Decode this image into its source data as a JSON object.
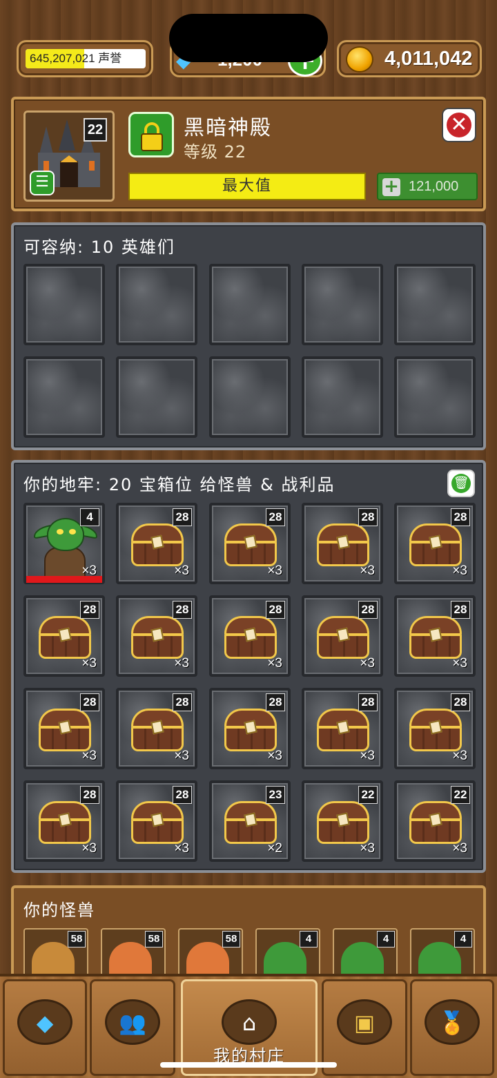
{
  "topbar": {
    "reputation_value": "645,207,021",
    "reputation_label": "声誉",
    "reputation_fill": 0.49,
    "gems_value": "1,200",
    "gold_value": "4,011,042"
  },
  "building": {
    "level_badge": "22",
    "name": "黑暗神殿",
    "level_text": "等级 22",
    "max_label": "最大值",
    "upgrade_cost": "121,000"
  },
  "heroes": {
    "title": "可容纳: 10 英雄们",
    "slot_count": 10
  },
  "dungeon": {
    "title": "你的地牢: 20 宝箱位 给怪兽 & 战利品",
    "items": [
      {
        "type": "goblin",
        "level": "4",
        "qty": "×3"
      },
      {
        "type": "chest",
        "level": "28",
        "qty": "×3"
      },
      {
        "type": "chest",
        "level": "28",
        "qty": "×3"
      },
      {
        "type": "chest",
        "level": "28",
        "qty": "×3"
      },
      {
        "type": "chest",
        "level": "28",
        "qty": "×3"
      },
      {
        "type": "chest",
        "level": "28",
        "qty": "×3"
      },
      {
        "type": "chest",
        "level": "28",
        "qty": "×3"
      },
      {
        "type": "chest",
        "level": "28",
        "qty": "×3"
      },
      {
        "type": "chest",
        "level": "28",
        "qty": "×3"
      },
      {
        "type": "chest",
        "level": "28",
        "qty": "×3"
      },
      {
        "type": "chest",
        "level": "28",
        "qty": "×3"
      },
      {
        "type": "chest",
        "level": "28",
        "qty": "×3"
      },
      {
        "type": "chest",
        "level": "28",
        "qty": "×3"
      },
      {
        "type": "chest",
        "level": "28",
        "qty": "×3"
      },
      {
        "type": "chest",
        "level": "28",
        "qty": "×3"
      },
      {
        "type": "chest",
        "level": "28",
        "qty": "×3"
      },
      {
        "type": "chest",
        "level": "28",
        "qty": "×3"
      },
      {
        "type": "chest",
        "level": "23",
        "qty": "×2"
      },
      {
        "type": "chest",
        "level": "22",
        "qty": "×3"
      },
      {
        "type": "chest",
        "level": "22",
        "qty": "×3"
      }
    ]
  },
  "monsters": {
    "title": "你的怪兽",
    "cards": [
      {
        "type": "pharaoh",
        "level": "58"
      },
      {
        "type": "flame-king",
        "level": "58"
      },
      {
        "type": "flame-king",
        "level": "58"
      },
      {
        "type": "goblin",
        "level": "4"
      },
      {
        "type": "goblin",
        "level": "4"
      },
      {
        "type": "goblin",
        "level": "4"
      }
    ]
  },
  "nav": {
    "tabs": [
      {
        "icon": "gem-icon",
        "label": ""
      },
      {
        "icon": "people-icon",
        "label": ""
      },
      {
        "icon": "house-icon",
        "label": "我的村庄",
        "active": true
      },
      {
        "icon": "chest-icon",
        "label": ""
      },
      {
        "icon": "medal-icon",
        "label": ""
      }
    ]
  },
  "colors": {
    "reputation_fill": "#f4ea1a",
    "max_bar": "#f4ec14",
    "accent_green": "#2f9c2a",
    "close_red": "#c8242a"
  }
}
